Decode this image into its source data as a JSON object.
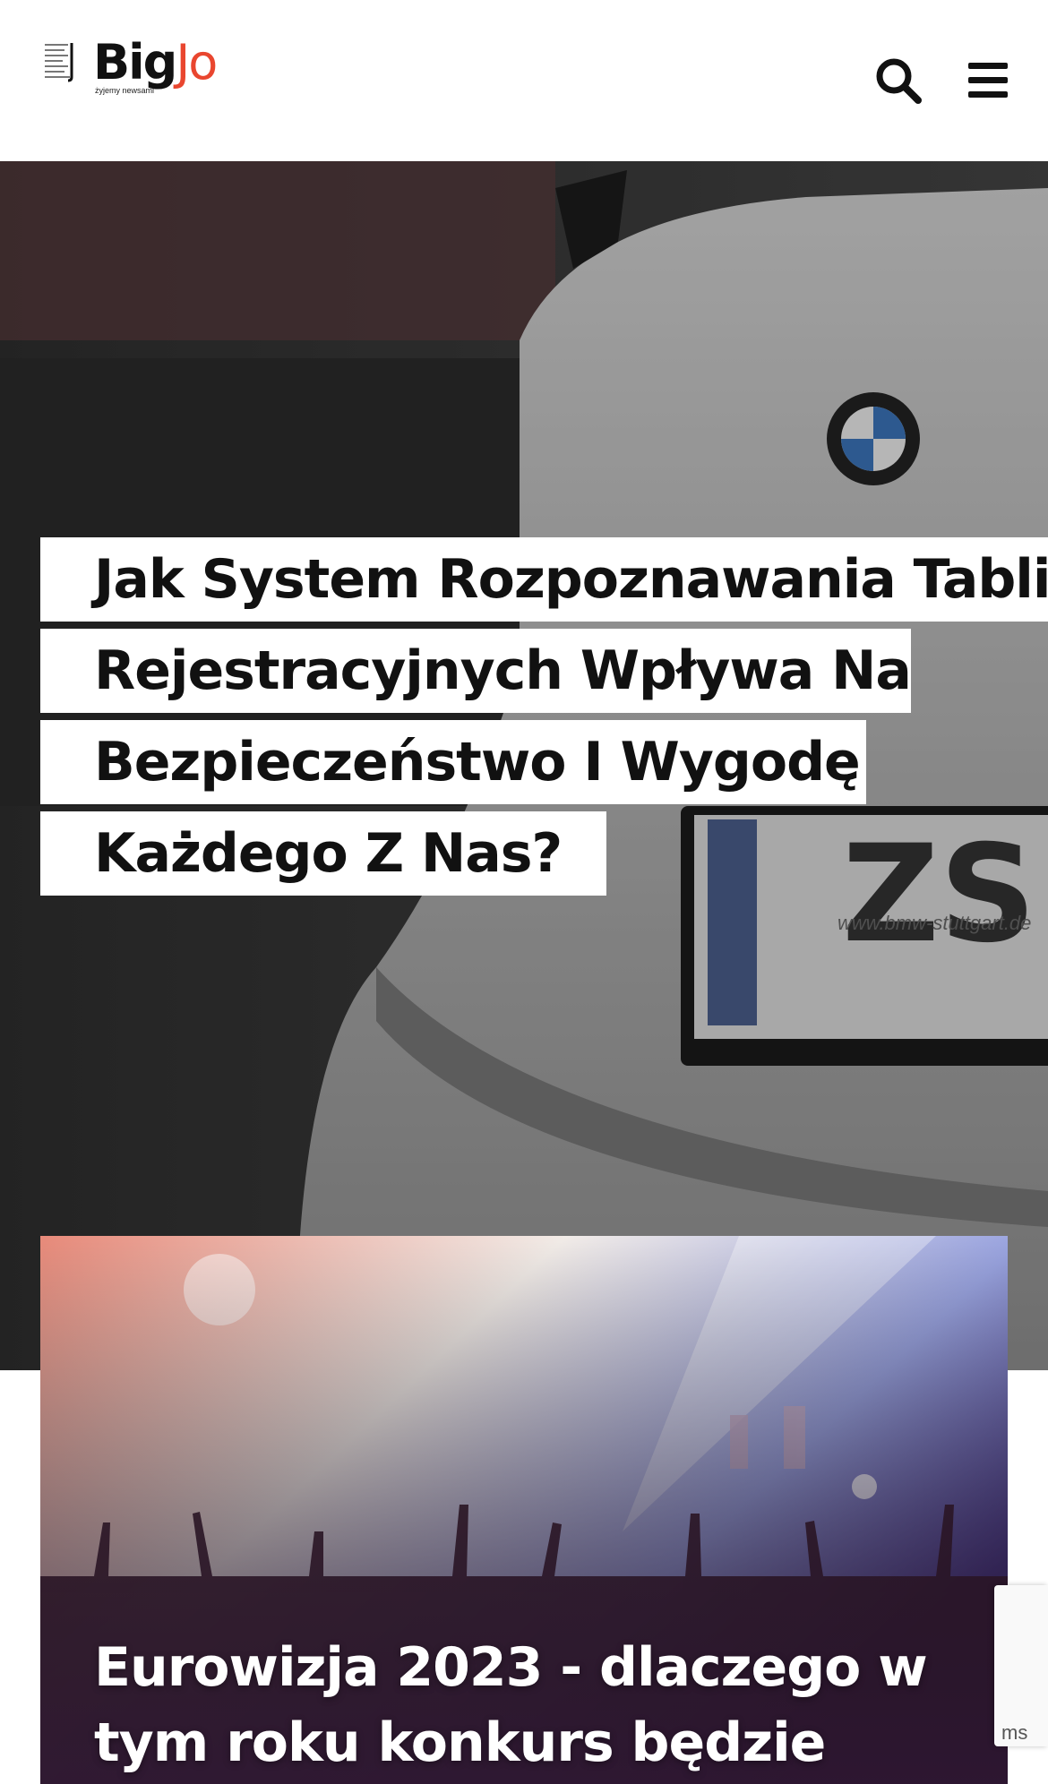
{
  "header": {
    "logo": {
      "text_main": "Big",
      "text_accent": "Jo",
      "tagline": "żyjemy newsami"
    },
    "icons": {
      "search": "search-icon",
      "menu": "hamburger-menu-icon"
    }
  },
  "hero": {
    "title_lines": [
      "Jak System Rozpoznawania Tablic",
      "Rejestracyjnych Wpływa Na",
      "Bezpieczeństwo I Wygodę",
      "Każdego Z Nas?"
    ],
    "image_plate_text": "www.bmw-stuttgart.de"
  },
  "card": {
    "title": "Eurowizja 2023 - dlaczego w tym roku konkurs będzie"
  },
  "recaptcha": {
    "partial_text": "ms"
  },
  "colors": {
    "accent": "#e9462f",
    "text": "#111111",
    "background": "#ffffff"
  }
}
